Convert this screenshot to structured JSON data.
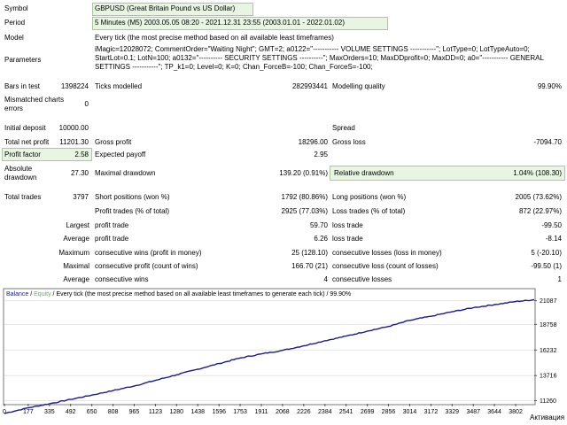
{
  "header": {
    "symbol_label": "Symbol",
    "symbol_value": "GBPUSD (Great Britain Pound vs US Dollar)",
    "period_label": "Period",
    "period_value": "5 Minutes (M5) 2003.05.05 08:20 - 2021.12.31 23:55 (2003.01.01 - 2022.01.02)",
    "model_label": "Model",
    "model_value": "Every tick (the most precise method based on all available least timeframes)",
    "parameters_label": "Parameters",
    "parameters_value": "iMagic=12028072; CommentOrder=\"Waiting Night\"; GMT=2; a0122=\"----------- VOLUME SETTINGS -----------\"; LotType=0; LotTypeAuto=0; StartLot=0.1; LotN=100; a0132=\"---------- SECURITY SETTINGS ----------\"; MaxOrders=10; MaxDDprofit=0; MaxDD=0; a0=\"----------- GENERAL SETTINGS -----------\"; TP_k1=0; Level=0; K=0; Chan_ForceB=-100; Chan_ForceS=-100;"
  },
  "stats": {
    "bars_label": "Bars in test",
    "bars_value": "1398224",
    "ticks_label": "Ticks modelled",
    "ticks_value": "282993441",
    "quality_label": "Modelling quality",
    "quality_value": "99.90%",
    "mismatched_label": "Mismatched charts errors",
    "mismatched_value": "0",
    "deposit_label": "Initial deposit",
    "deposit_value": "10000.00",
    "spread_label": "Spread",
    "netprofit_label": "Total net profit",
    "netprofit_value": "11201.30",
    "grossprofit_label": "Gross profit",
    "grossprofit_value": "18296.00",
    "grossloss_label": "Gross loss",
    "grossloss_value": "-7094.70",
    "pf_label": "Profit factor",
    "pf_value": "2.58",
    "payoff_label": "Expected payoff",
    "payoff_value": "2.95",
    "absdd_label": "Absolute drawdown",
    "absdd_value": "27.30",
    "maxdd_label": "Maximal drawdown",
    "maxdd_value": "139.20 (0.91%)",
    "reldd_label": "Relative drawdown",
    "reldd_value": "1.04% (108.30)",
    "trades_label": "Total trades",
    "trades_value": "3797",
    "short_label": "Short positions (won %)",
    "short_value": "1792 (80.86%)",
    "long_label": "Long positions (won %)",
    "long_value": "2005 (73.62%)",
    "pt_label": "Profit trades (% of total)",
    "pt_value": "2925 (77.03%)",
    "lt_label": "Loss trades (% of total)",
    "lt_value": "872 (22.97%)",
    "largest_label": "Largest",
    "largest_pt_label": "profit trade",
    "largest_pt_value": "59.70",
    "largest_lt_label": "loss trade",
    "largest_lt_value": "-99.50",
    "average_label": "Average",
    "average_pt_label": "profit trade",
    "average_pt_value": "6.26",
    "average_lt_label": "loss trade",
    "average_lt_value": "-8.14",
    "maximum_label": "Maximum",
    "max_cw_label": "consecutive wins (profit in money)",
    "max_cw_value": "25 (128.10)",
    "max_cl_label": "consecutive losses (loss in money)",
    "max_cl_value": "5 (-20.10)",
    "maximal_label": "Maximal",
    "mxl_cp_label": "consecutive profit (count of wins)",
    "mxl_cp_value": "166.70 (21)",
    "mxl_cl_label": "consecutive loss (count of losses)",
    "mxl_cl_value": "-99.50 (1)",
    "avg2_label": "Average",
    "avg_cw_label": "consecutive wins",
    "avg_cw_value": "4",
    "avg_cl_label": "consecutive losses",
    "avg_cl_value": "1"
  },
  "chart_legend": {
    "balance": "Balance",
    "sep1": " / ",
    "equity": "Equity",
    "desc": " / Every tick (the most precise method based on all available least timeframes to generate each tick) / 99.90%"
  },
  "colors": {
    "balance": "#1a1a8c",
    "equity": "#5cb85c",
    "highlight": "#e8f5e2",
    "label_gray": "#555555"
  },
  "watermark": "Активация",
  "chart_data": {
    "type": "line",
    "x_ticks": [
      "0",
      "177",
      "335",
      "492",
      "650",
      "808",
      "965",
      "1123",
      "1280",
      "1438",
      "1596",
      "1753",
      "1911",
      "2068",
      "2226",
      "2384",
      "2541",
      "2699",
      "2856",
      "3014",
      "3172",
      "3329",
      "3487",
      "3644",
      "3802"
    ],
    "y_ticks": [
      "11260",
      "13716",
      "16232",
      "18758",
      "21087"
    ],
    "xlim": [
      0,
      3940
    ],
    "ylim": [
      10950,
      21400
    ],
    "series": [
      {
        "name": "Balance",
        "x": [
          0,
          177,
          335,
          492,
          650,
          808,
          965,
          1123,
          1280,
          1438,
          1596,
          1753,
          1911,
          2068,
          2226,
          2384,
          2541,
          2699,
          2856,
          3014,
          3172,
          3329,
          3487,
          3644,
          3802,
          3940
        ],
        "y": [
          10000,
          10550,
          10950,
          11380,
          11800,
          12250,
          12700,
          13250,
          13800,
          14350,
          14900,
          15450,
          15850,
          16200,
          16650,
          17150,
          17600,
          18100,
          18550,
          19150,
          19550,
          20000,
          20400,
          20700,
          21000,
          21180
        ]
      }
    ]
  }
}
